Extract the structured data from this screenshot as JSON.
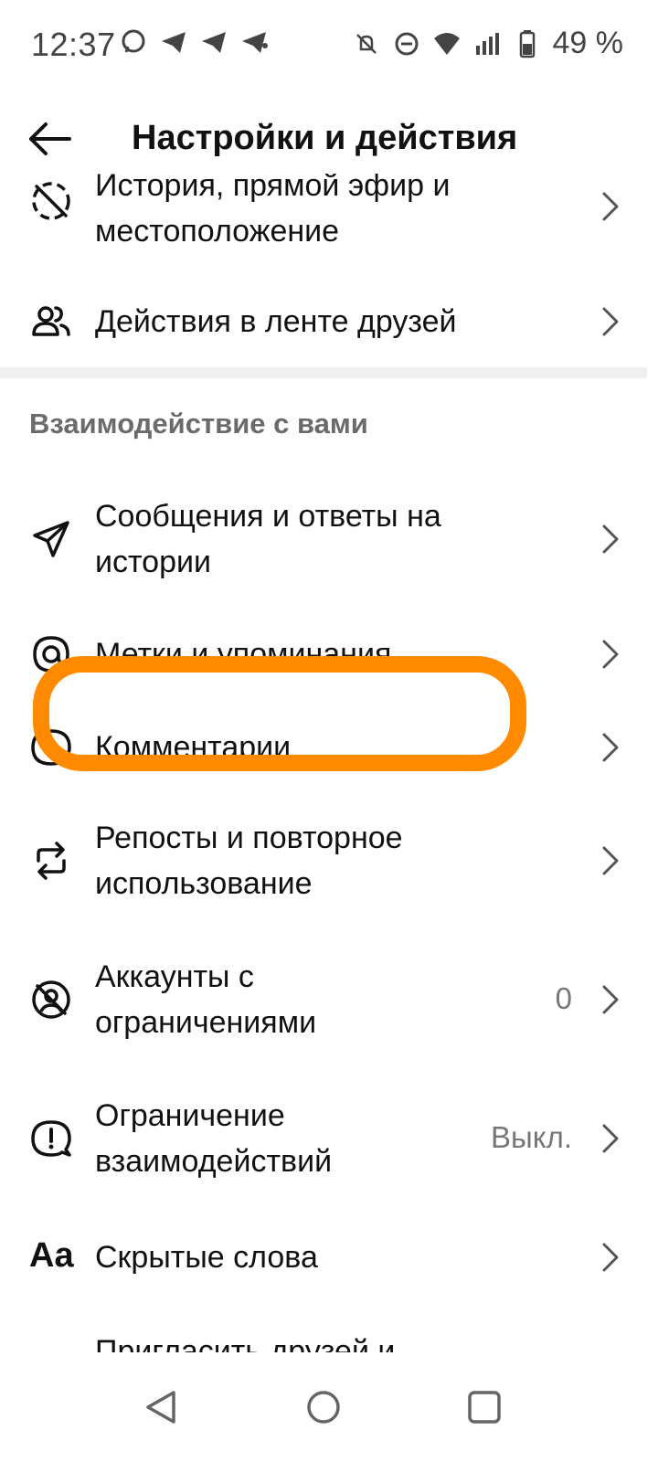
{
  "status_bar": {
    "time": "12:37",
    "battery": "49 %"
  },
  "header": {
    "title": "Настройки и действия"
  },
  "items_top": [
    {
      "label": "История, прямой эфир и местоположение",
      "icon": "story-location-icon"
    },
    {
      "label": "Действия в ленте друзей",
      "icon": "friends-icon"
    }
  ],
  "section": {
    "title": "Взаимодействие с вами"
  },
  "items": [
    {
      "label": "Сообщения и ответы на истории",
      "icon": "message-icon",
      "value": ""
    },
    {
      "label": "Метки и упоминания",
      "icon": "at-icon",
      "value": ""
    },
    {
      "label": "Комментарии",
      "icon": "comment-icon",
      "value": ""
    },
    {
      "label": "Репосты и повторное использование",
      "icon": "repost-icon",
      "value": ""
    },
    {
      "label": "Аккаунты с ограничениями",
      "icon": "restricted-icon",
      "value": "0"
    },
    {
      "label": "Ограничение взаимодействий",
      "icon": "limit-icon",
      "value": "Выкл."
    },
    {
      "label": "Скрытые слова",
      "icon": "text-icon",
      "value": ""
    },
    {
      "label": "Пригласить друзей и",
      "icon": "invite-icon",
      "value": ""
    }
  ],
  "colors": {
    "highlight": "#ff8a00",
    "divider": "#efefef",
    "secondary_text": "#6b6b6b"
  }
}
